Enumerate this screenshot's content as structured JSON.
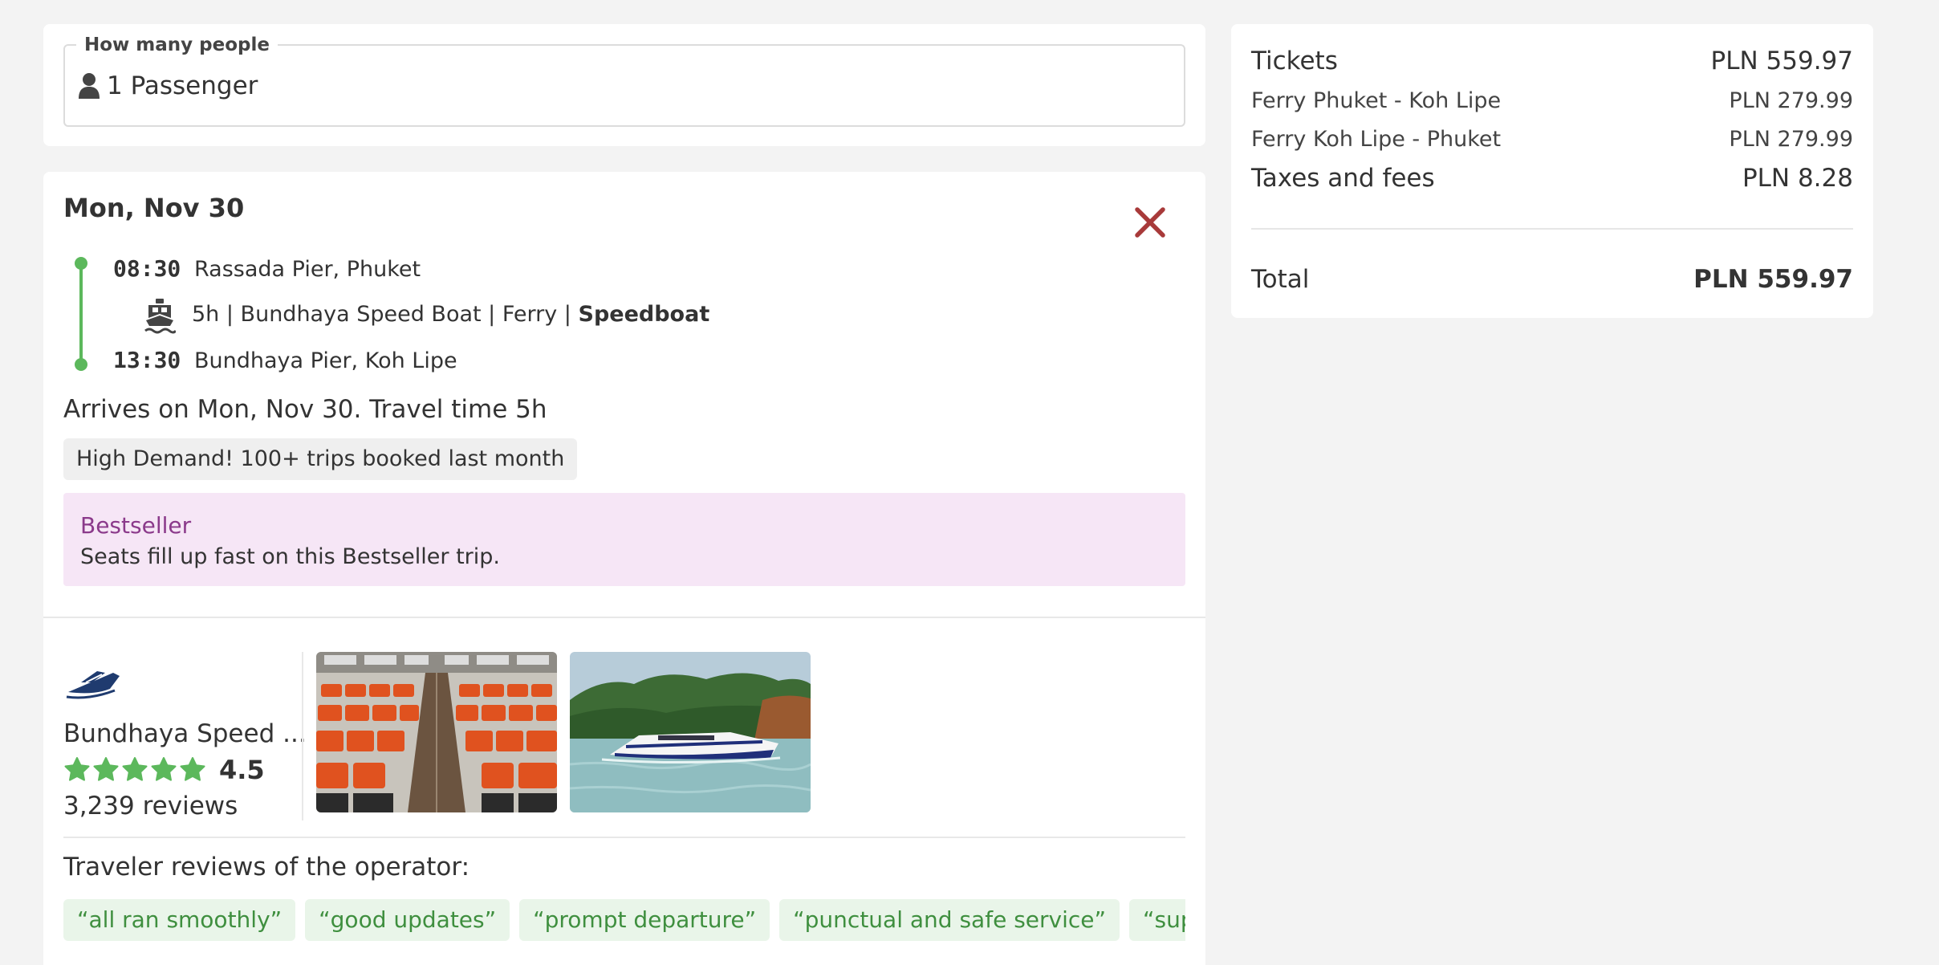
{
  "people": {
    "legend": "How many people",
    "value": "1 Passenger"
  },
  "trip": {
    "date": "Mon, Nov 30",
    "departure": {
      "time": "08:30",
      "place": "Rassada Pier, Phuket"
    },
    "arrival": {
      "time": "13:30",
      "place": "Bundhaya Pier, Koh Lipe"
    },
    "route_detail_prefix": "5h | Bundhaya Speed Boat | Ferry | ",
    "route_detail_type": "Speedboat",
    "arrives_text": "Arrives on Mon, Nov 30. Travel time 5h",
    "demand_badge": "High Demand! 100+ trips booked last month",
    "bestseller": {
      "title": "Bestseller",
      "text": "Seats fill up fast on this Bestseller trip."
    },
    "operator": {
      "name": "Bundhaya Speed ...",
      "rating": "4.5",
      "stars": 5,
      "reviews": "3,239 reviews"
    },
    "reviews_heading": "Traveler reviews of the operator:",
    "review_chips": [
      "“all ran smoothly”",
      "“good updates”",
      "“prompt departure”",
      "“punctual and safe service”",
      "“super qu"
    ]
  },
  "price": {
    "tickets_label": "Tickets",
    "tickets_amount": "PLN 559.97",
    "line1_label": "Ferry Phuket - Koh Lipe",
    "line1_amount": "PLN 279.99",
    "line2_label": "Ferry Koh Lipe - Phuket",
    "line2_amount": "PLN 279.99",
    "taxes_label": "Taxes and fees",
    "taxes_amount": "PLN 8.28",
    "total_label": "Total",
    "total_amount": "PLN 559.97"
  },
  "colors": {
    "accent_green": "#5cb85c",
    "close_red": "#a83a3a",
    "bestseller_purple": "#8b3a8b",
    "chip_green": "#3f8f3f",
    "logo_navy": "#1f3b6f"
  },
  "icons": {
    "passenger": "person-icon",
    "close": "close-icon",
    "boat": "ferry-icon",
    "logo": "speedboat-logo-icon",
    "star": "star-icon"
  }
}
